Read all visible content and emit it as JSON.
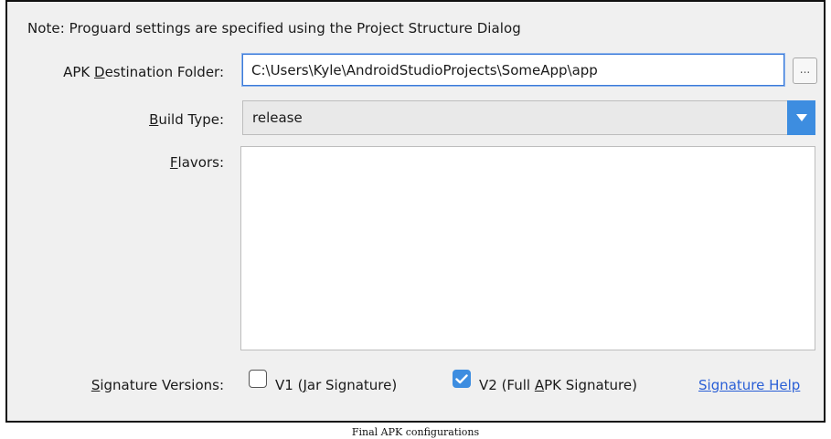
{
  "dialog": {
    "note": "Note: Proguard settings are specified using the Project Structure Dialog",
    "apk_destination": {
      "label_pre": "APK ",
      "label_mn": "D",
      "label_post": "estination Folder:",
      "value": "C:\\Users\\Kyle\\AndroidStudioProjects\\SomeApp\\app",
      "browse_label": "..."
    },
    "build_type": {
      "label_mn": "B",
      "label_post": "uild Type:",
      "selected": "release"
    },
    "flavors": {
      "label_mn": "F",
      "label_post": "lavors:",
      "items": []
    },
    "signature_versions": {
      "label_mn": "S",
      "label_post": "ignature Versions:",
      "v1": {
        "label_pre": "V1 (",
        "label_mn": "J",
        "label_post": "ar Signature)",
        "checked": false
      },
      "v2": {
        "label_pre": "V2 (Full ",
        "label_mn": "A",
        "label_post": "PK Signature)",
        "checked": true
      },
      "help_link": "Signature Help"
    }
  },
  "caption": "Final APK configurations",
  "colors": {
    "accent": "#3d8de0",
    "link": "#2a5fd6",
    "dialog_bg": "#f0f0f0"
  },
  "icons": {
    "dropdown": "chevron-down-icon",
    "checkmark": "check-icon"
  }
}
